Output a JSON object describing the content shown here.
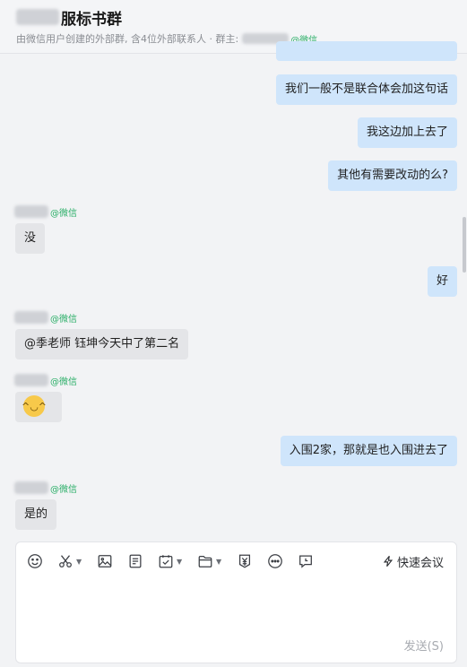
{
  "header": {
    "title": "服标书群",
    "subtitle_prefix": "由微信用户创建的外部群, 含4位外部联系人 · 群主:",
    "wechat_tag": "@微信"
  },
  "messages": [
    {
      "side": "right",
      "text": "我们一般不是联合体会加这句话"
    },
    {
      "side": "right",
      "text": "我这边加上去了"
    },
    {
      "side": "right",
      "text": "其他有需要改动的么?"
    },
    {
      "side": "left",
      "sender_tag": "@微信",
      "text": "没"
    },
    {
      "side": "right",
      "text": "好"
    },
    {
      "side": "left",
      "sender_tag": "@微信",
      "text": "@季老师  钰坤今天中了第二名"
    },
    {
      "side": "left",
      "sender_tag": "@微信",
      "emoji": "laughing-tears"
    },
    {
      "side": "right",
      "text": "入围2家，那就是也入围进去了"
    },
    {
      "side": "left",
      "sender_tag": "@微信",
      "text": "是的"
    }
  ],
  "composer": {
    "tools": [
      "emoji-icon",
      "scissors-icon",
      "image-icon",
      "document-icon",
      "calendar-check-icon",
      "folder-icon",
      "yuan-icon",
      "more-icon",
      "chat-note-icon"
    ],
    "meeting_label": "快速会议",
    "send_label": "发送(S)"
  },
  "colors": {
    "my_bubble": "#cfe5fb",
    "their_bubble": "#e4e5e8",
    "wechat_green": "#2aae67"
  }
}
